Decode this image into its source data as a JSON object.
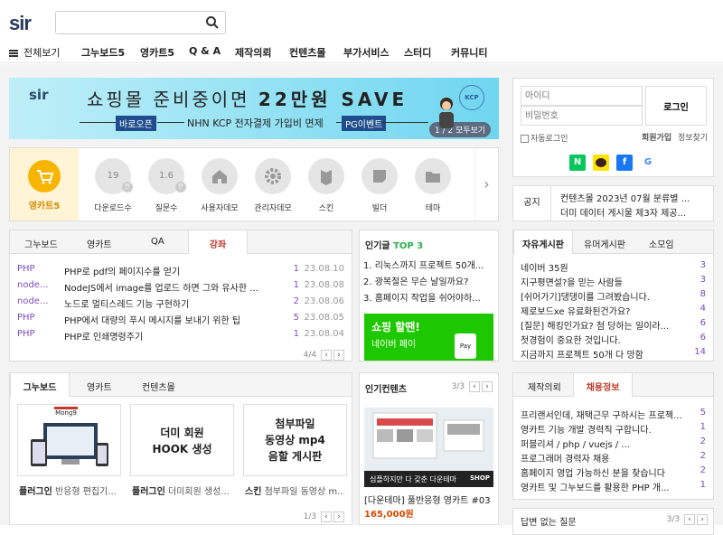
{
  "header": {
    "logo": "sir",
    "search_placeholder": ""
  },
  "nav": {
    "menu_label": "전체보기",
    "items": [
      "그누보드5",
      "영카트5",
      "Q & A",
      "제작의뢰",
      "컨텐츠몰",
      "부가서비스",
      "스터디",
      "커뮤니티"
    ]
  },
  "banner": {
    "logo": "sir",
    "title_a": "쇼핑몰 준비중이면 ",
    "title_b": "22만원 SAVE",
    "tag1": "바로오픈",
    "middle": "NHN KCP 전자결제 가입비 면제",
    "tag2": "PG이벤트",
    "kcp": "KCP",
    "pager": "1 / 2  모두보기"
  },
  "login": {
    "id_placeholder": "아이디",
    "pw_placeholder": "비밀번호",
    "login_btn": "로그인",
    "auto_login": "자동로그인",
    "join": "회원가입",
    "find": "정보찾기",
    "social": [
      "N",
      "",
      "f",
      "G"
    ],
    "colors": {
      "naver": "#03c75a",
      "kakao": "#fee500",
      "facebook": "#1877f2"
    }
  },
  "categories": {
    "first": "영카트5",
    "items": [
      {
        "icon": "19",
        "badge": "만",
        "label": "다운로드수"
      },
      {
        "icon": "1.6",
        "badge": "만",
        "label": "질문수"
      },
      {
        "icon": "home-icon",
        "label": "사용자데모"
      },
      {
        "icon": "gear-icon",
        "label": "관리자데모"
      },
      {
        "icon": "skin-icon",
        "label": "스킨"
      },
      {
        "icon": "note-icon",
        "label": "빌더"
      },
      {
        "icon": "folder-icon",
        "label": "테마"
      }
    ]
  },
  "notice": {
    "label": "공지",
    "items": [
      "컨텐츠몰 2023년 07월 분류별 ...",
      "더미 데이터 게시물 제3자 제공..."
    ]
  },
  "qa": {
    "tabs": [
      "그누보드",
      "영카트",
      "QA",
      "강좌"
    ],
    "rows": [
      {
        "cat": "PHP",
        "title": "PHP로 pdf의 페이지수를 얻기",
        "count": "1",
        "date": "23.08.10"
      },
      {
        "cat": "node...",
        "title": "NodeJS에서 image를 업로드 하면 그와 유사한 ...",
        "count": "1",
        "date": "23.08.08"
      },
      {
        "cat": "node...",
        "title": "노드로 멀티스레드 기능 구현하기",
        "count": "2",
        "date": "23.08.06"
      },
      {
        "cat": "PHP",
        "title": "PHP에서 대량의 푸시 메시지를 보내기 위한 팁",
        "count": "5",
        "date": "23.08.05"
      },
      {
        "cat": "PHP",
        "title": "PHP로 인쇄명령주기",
        "count": "1",
        "date": "23.08.04"
      }
    ],
    "pager": "4/4"
  },
  "popular": {
    "title": "인기글",
    "top": "TOP 3",
    "items": [
      "1. 리눅스까지 프로젝트 50개...",
      "2. 광복절은 무슨 날일까요?",
      "3. 홈페이지 작업을 쉬어야하..."
    ],
    "ad_title": "쇼핑 할땐!",
    "ad_sub": "네이버 페이",
    "ad_pay": "Pay"
  },
  "free": {
    "tabs": [
      "자유게시판",
      "유머게시판",
      "소모임"
    ],
    "rows": [
      {
        "title": "네이버 35원",
        "count": "3"
      },
      {
        "title": "지구평면설?을 믿는 사람들",
        "count": "3"
      },
      {
        "title": "[쉬어가기]댕댕이를 그려봤습니다.",
        "count": "8"
      },
      {
        "title": "제로보드xe 유료화된건가요?",
        "count": "4"
      },
      {
        "title": "[질문] 해킹인가요? 첨 당하는 일이라...",
        "count": "6"
      },
      {
        "title": "첫경험이 중요한 것입니다.",
        "count": "6"
      },
      {
        "title": "지금까지 프로젝트 50개 다 망함",
        "count": "14"
      }
    ]
  },
  "gallery": {
    "tabs": [
      "그누보드",
      "영카트",
      "컨텐츠몰"
    ],
    "items": [
      {
        "prefix": "플러그인",
        "text": "반응형 편집기..."
      },
      {
        "prefix": "플러그인",
        "text": "더미회원 생성..."
      },
      {
        "prefix": "스킨",
        "text": "첨부파일 동영상 m..."
      }
    ],
    "thumb2": "더미 회원\nHOOK 생성",
    "thumb3a": "첨부파일",
    "thumb3b": "동영상 mp4",
    "thumb3c": "음할 게시판",
    "thumb1_top": "Mong9",
    "pager": "1/3"
  },
  "popular_contents": {
    "title": "인기컨텐츠",
    "pager": "3/3",
    "caption": "[다운테마] 풀반응형 영카트 #03",
    "price": "165,000원",
    "img_text": "심플하지만 다 갖춘 다운테마",
    "shop": "SHOP"
  },
  "jobs": {
    "tabs": [
      "제작의뢰",
      "채용정보"
    ],
    "rows": [
      {
        "title": "프리랜서인데, 재택근무 구하시는 프로젝...",
        "count": "5"
      },
      {
        "title": "영카트 기능 개발 경력직 구합니다.",
        "count": "1"
      },
      {
        "title": "퍼블리셔 / php / vuejs / ...",
        "count": "2"
      },
      {
        "title": "프로그래머 경력자 채용",
        "count": "2"
      },
      {
        "title": "홈페이지 영업 가능하신 분을 찾습니다",
        "count": "2"
      },
      {
        "title": "영카트 및 그누보드를 활용한 PHP 개...",
        "count": "1"
      }
    ]
  },
  "unanswered": {
    "title": "답변 없는 질문",
    "pager": "3/3"
  }
}
